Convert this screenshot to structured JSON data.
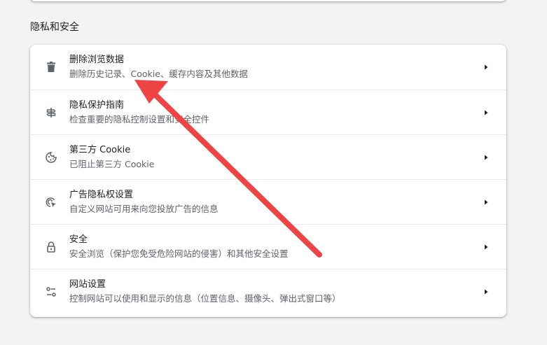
{
  "section": {
    "title": "隐私和安全"
  },
  "rows": [
    {
      "icon": "trash-icon",
      "title": "删除浏览数据",
      "desc": "删除历史记录、Cookie、缓存内容及其他数据"
    },
    {
      "icon": "privacy-guide-icon",
      "title": "隐私保护指南",
      "desc": "检查重要的隐私控制设置和安全控件"
    },
    {
      "icon": "cookie-icon",
      "title": "第三方 Cookie",
      "desc": "已阻止第三方 Cookie"
    },
    {
      "icon": "ad-privacy-icon",
      "title": "广告隐私权设置",
      "desc": "自定义网站可用来向您投放广告的信息"
    },
    {
      "icon": "lock-icon",
      "title": "安全",
      "desc": "安全浏览（保护您免受危险网站的侵害）和其他安全设置"
    },
    {
      "icon": "site-settings-icon",
      "title": "网站设置",
      "desc": "控制网站可以使用和显示的信息（位置信息、摄像头、弹出式窗口等）"
    }
  ],
  "colors": {
    "arrow": "#ee4444",
    "text_primary": "#202124",
    "text_secondary": "#5f6368",
    "background": "#f1f3f4"
  }
}
